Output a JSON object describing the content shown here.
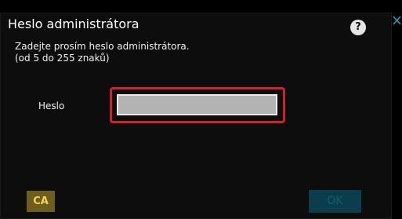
{
  "dialog": {
    "title": "Heslo administrátora",
    "help_label": "?",
    "instruction_line1": "Zadejte prosím heslo administrátora.",
    "instruction_line2": "(od 5 do 255 znaků)"
  },
  "password_field": {
    "label": "Heslo",
    "value": "",
    "placeholder": ""
  },
  "buttons": {
    "ca_label": "CA",
    "ok_label": "OK"
  },
  "colors": {
    "highlight_border": "#d32031",
    "ca_background": "#6d5e1b",
    "ca_text": "#f7d35a",
    "ok_background": "#0b3e4d",
    "ok_text": "#0f5f72",
    "close_icon": "#1b9fbf"
  },
  "icons": {
    "help": "help-icon",
    "close": "close-icon"
  }
}
